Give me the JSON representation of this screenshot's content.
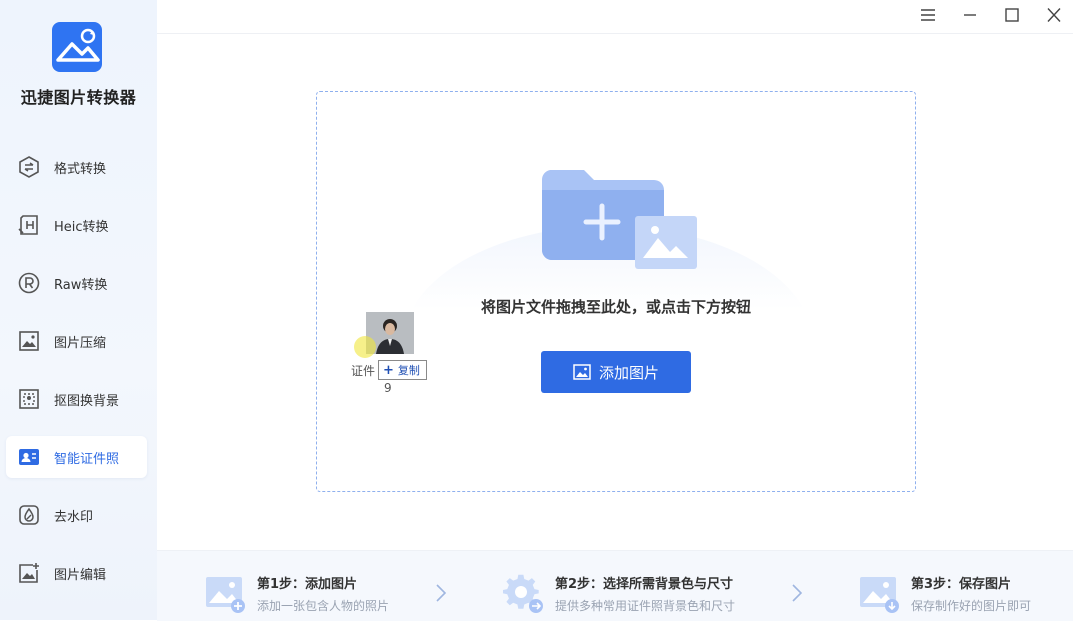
{
  "app": {
    "title": "迅捷图片转换器"
  },
  "sidebar": {
    "items": [
      {
        "label": "格式转换",
        "icon": "format-convert-icon",
        "active": false
      },
      {
        "label": "Heic转换",
        "icon": "heic-icon",
        "active": false
      },
      {
        "label": "Raw转换",
        "icon": "raw-icon",
        "active": false
      },
      {
        "label": "图片压缩",
        "icon": "image-compress-icon",
        "active": false
      },
      {
        "label": "抠图换背景",
        "icon": "cutout-icon",
        "active": false
      },
      {
        "label": "智能证件照",
        "icon": "id-photo-icon",
        "active": true
      },
      {
        "label": "去水印",
        "icon": "watermark-remove-icon",
        "active": false
      },
      {
        "label": "图片编辑",
        "icon": "image-edit-icon",
        "active": false
      }
    ]
  },
  "window_controls": [
    "menu-icon",
    "minimize-icon",
    "maximize-icon",
    "close-icon"
  ],
  "main": {
    "drop_hint": "将图片文件拖拽至此处，或点击下方按钮",
    "add_button": "添加图片"
  },
  "drag_overlay": {
    "file_name_line1": "证件",
    "file_name_line2": "9",
    "tooltip": "复制"
  },
  "steps": [
    {
      "title": "第1步：添加图片",
      "desc": "添加一张包含人物的照片",
      "icon": "add-image-icon"
    },
    {
      "title": "第2步：选择所需背景色与尺寸",
      "desc": "提供多种常用证件照背景色和尺寸",
      "icon": "settings-gear-icon"
    },
    {
      "title": "第3步：保存图片",
      "desc": "保存制作好的图片即可",
      "icon": "save-image-icon"
    }
  ],
  "colors": {
    "accent": "#2f6be3",
    "sidebar_bg": "#eef4fd",
    "dashed_border": "#8fb0ee"
  }
}
